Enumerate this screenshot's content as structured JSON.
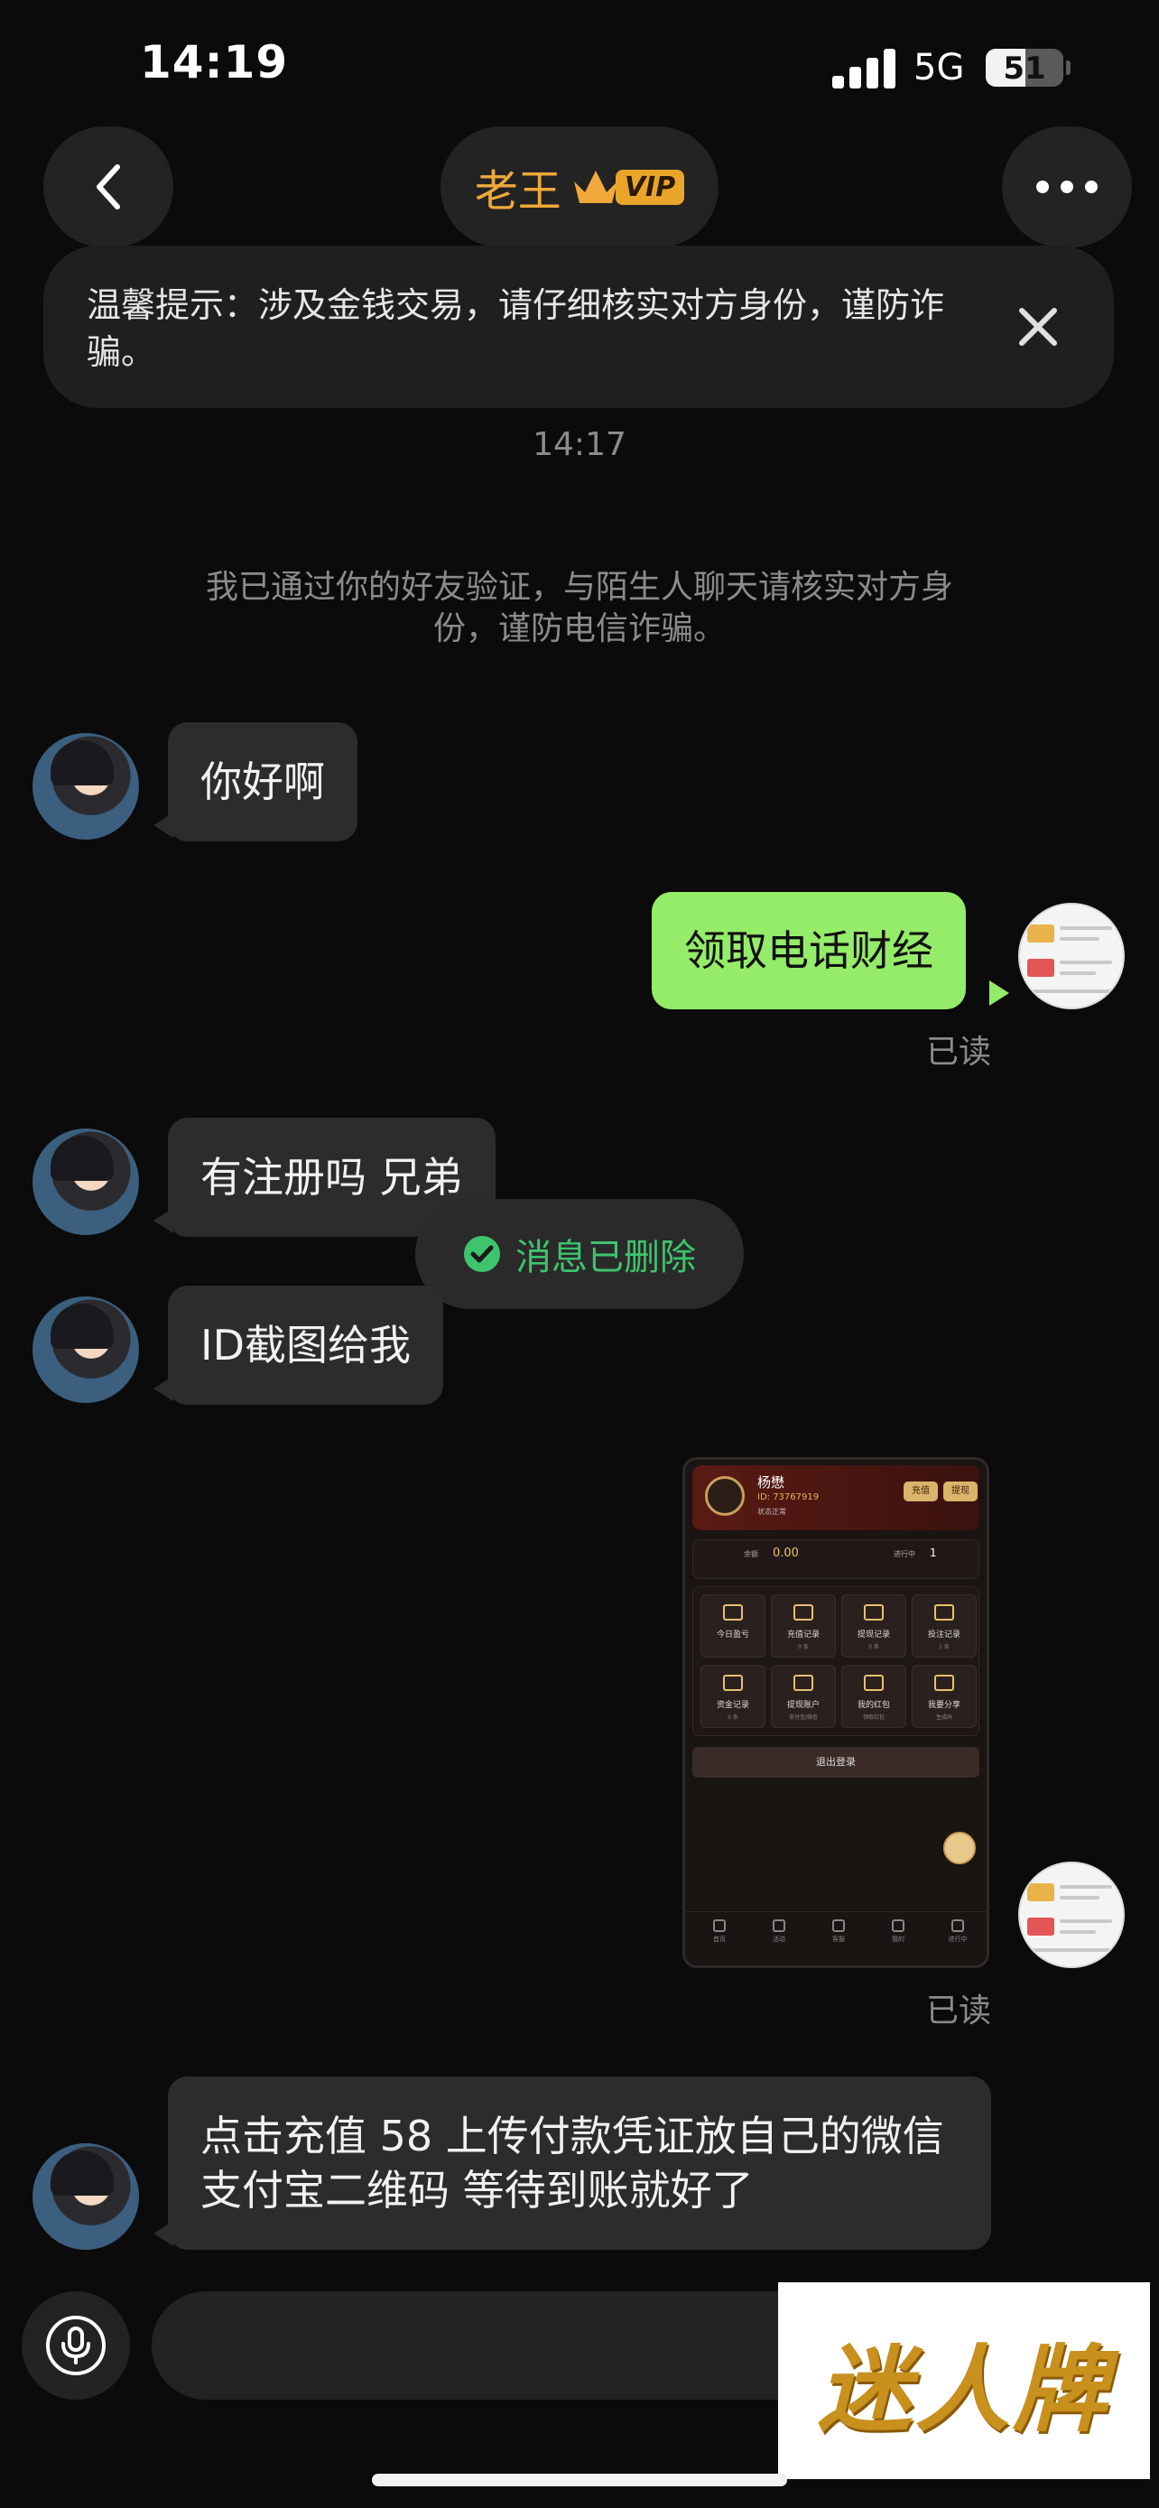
{
  "status_bar": {
    "time": "14:19",
    "network": "5G",
    "battery": "51",
    "battery_level": 0.51
  },
  "header": {
    "title": "老王",
    "vip_badge": "VIP"
  },
  "banner": {
    "text": "温馨提示：涉及金钱交易，请仔细核实对方身份，谨防诈骗。"
  },
  "timestamp": "14:17",
  "system_message": "我已通过你的好友验证，与陌生人聊天请核实对方身份，谨防电信诈骗。",
  "messages": [
    {
      "from": "other",
      "text": "你好啊"
    },
    {
      "from": "self",
      "text": "领取电话财经",
      "status": "已读"
    },
    {
      "from": "other",
      "text": "有注册吗 兄弟"
    },
    {
      "from": "other",
      "text": "ID截图给我"
    },
    {
      "from": "self",
      "type": "image",
      "status": "已读"
    },
    {
      "from": "other",
      "text": "点击充值 58 上传付款凭证放自己的微信支付宝二维码 等待到账就好了"
    }
  ],
  "toast": {
    "text": "消息已删除"
  },
  "screenshot": {
    "name": "杨懋",
    "id": "ID: 73767919",
    "subtitle": "状态正常",
    "btn_recharge": "充值",
    "btn_withdraw": "提现",
    "balance_label": "余额",
    "balance_value": "0.00",
    "ongoing_label": "进行中",
    "ongoing_value": "1",
    "grid": [
      {
        "label": "今日盈亏",
        "sub": ""
      },
      {
        "label": "充值记录",
        "sub": "0 条"
      },
      {
        "label": "提现记录",
        "sub": "0 条"
      },
      {
        "label": "投注记录",
        "sub": "1 条"
      },
      {
        "label": "资金记录",
        "sub": "0 条"
      },
      {
        "label": "提现账户",
        "sub": "支付宝/微信"
      },
      {
        "label": "我的红包",
        "sub": "领取红包"
      },
      {
        "label": "我要分享",
        "sub": "生成码"
      }
    ],
    "logout": "退出登录",
    "tabs": [
      "首页",
      "活动",
      "客服",
      "我的",
      "进行中"
    ]
  },
  "logo": {
    "text": "迷人牌"
  },
  "colors": {
    "outgoing_bubble": "#95ec69",
    "incoming_bubble": "#2c2c2c",
    "title_gold": "#f0a93a",
    "toast_green": "#3ec46d"
  }
}
